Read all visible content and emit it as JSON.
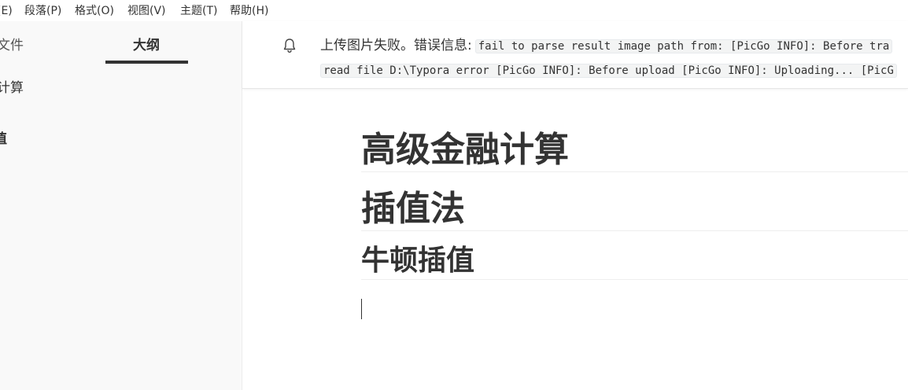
{
  "menubar": {
    "items": [
      "(E)",
      "段落(P)",
      "格式(O)",
      "视图(V)",
      "主题(T)",
      "帮助(H)"
    ]
  },
  "sidebar": {
    "tabs": {
      "files": "文件",
      "outline": "大纲"
    },
    "outline": [
      "计算",
      "值"
    ]
  },
  "notification": {
    "icon": "bell-icon",
    "label": "上传图片失败。错误信息:",
    "message_line1": "fail to parse result image path from: [PicGo INFO]: Before tra",
    "message_line2": "read file D:\\Typora error [PicGo INFO]: Before upload [PicGo INFO]: Uploading... [PicG"
  },
  "document": {
    "heading1_a": "高级金融计算",
    "heading1_b": "插值法",
    "heading2": "牛顿插值"
  }
}
